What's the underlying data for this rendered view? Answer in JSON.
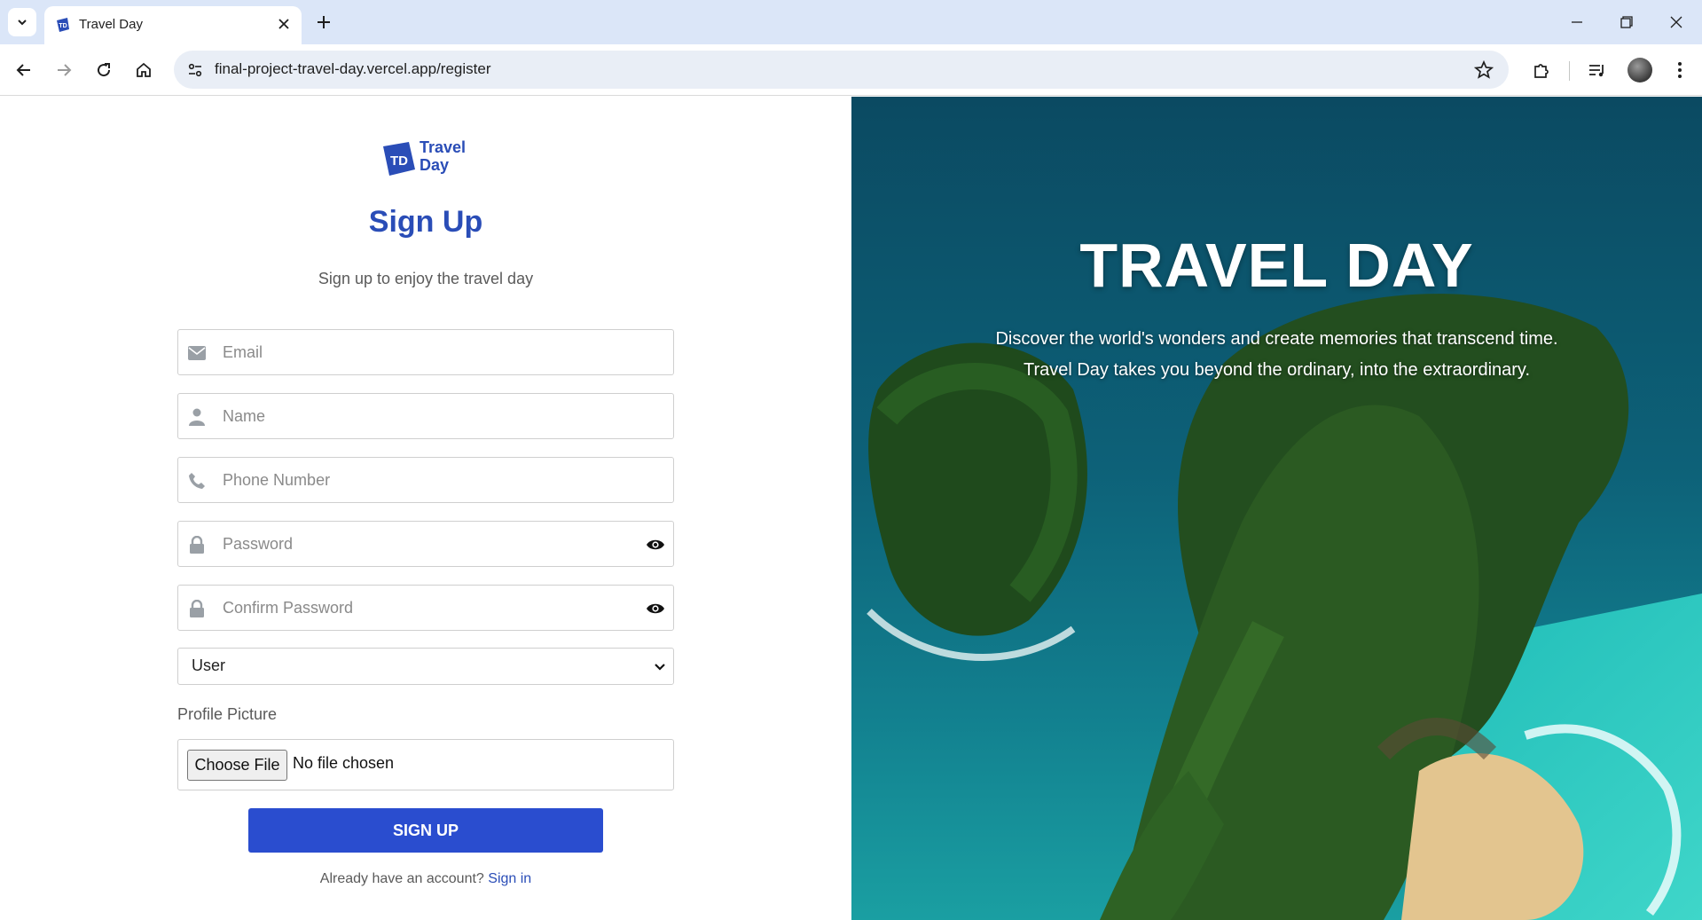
{
  "browser": {
    "tab_title": "Travel Day",
    "url": "final-project-travel-day.vercel.app/register"
  },
  "brand": {
    "logo_initials": "TD",
    "logo_line1": "Travel",
    "logo_line2": "Day",
    "primary_color": "#2a4db7",
    "button_color": "#2a4dcf"
  },
  "form": {
    "title": "Sign Up",
    "subtitle": "Sign up to enjoy the travel day",
    "email_placeholder": "Email",
    "name_placeholder": "Name",
    "phone_placeholder": "Phone Number",
    "password_placeholder": "Password",
    "confirm_password_placeholder": "Confirm Password",
    "role_selected": "User",
    "profile_picture_label": "Profile Picture",
    "file_button_label": "Choose File",
    "file_status": "No file chosen",
    "submit_label": "SIGN UP",
    "already_text": "Already have an account?",
    "signin_link": "Sign in"
  },
  "hero": {
    "title": "TRAVEL DAY",
    "line1": "Discover the world's wonders and create memories that transcend time.",
    "line2": "Travel Day takes you beyond the ordinary, into the extraordinary."
  }
}
